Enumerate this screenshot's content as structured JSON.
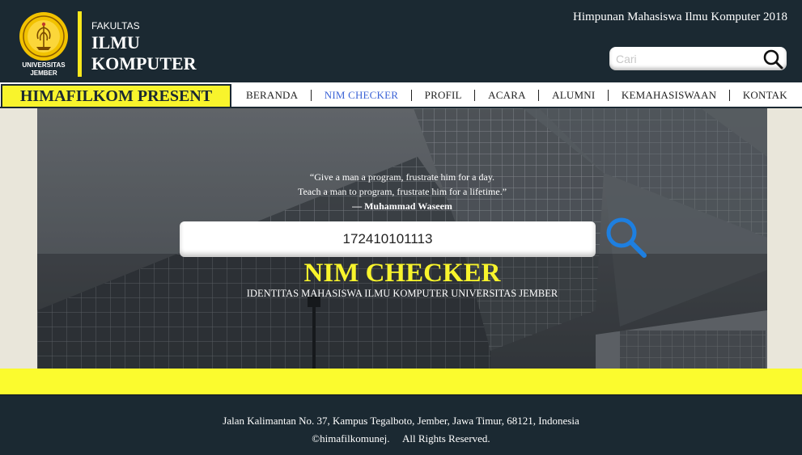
{
  "header": {
    "logo_caption_line1": "UNIVERSITAS",
    "logo_caption_line2": "JEMBER",
    "faculty_small": "FAKULTAS",
    "faculty_line1": "ILMU",
    "faculty_line2": "KOMPUTER",
    "org_title": "Himpunan Mahasiswa Ilmu Komputer 2018",
    "search_placeholder": "Cari",
    "search_icon": "search-icon"
  },
  "nav": {
    "present_label": "HIMAFILKOM PRESENT",
    "links": [
      {
        "label": "BERANDA"
      },
      {
        "label": "NIM CHECKER",
        "active": true
      },
      {
        "label": "PROFIL"
      },
      {
        "label": "ACARA"
      },
      {
        "label": "ALUMNI"
      },
      {
        "label": "KEMAHASISWAAN"
      },
      {
        "label": "KONTAK"
      }
    ]
  },
  "hero": {
    "quote_line1": "“Give a man a program, frustrate him for a day.",
    "quote_line2": "Teach a man to program, frustrate him for a lifetime.”",
    "quote_author": "— Muhammad Waseem",
    "nim_value": "172410101113",
    "search_icon": "search-icon",
    "title": "NIM CHECKER",
    "subtitle": "IDENTITAS MAHASISWA ILMU KOMPUTER UNIVERSITAS JEMBER"
  },
  "footer": {
    "address": "Jalan Kalimantan No. 37, Kampus Tegalboto, Jember, Jawa Timur, 68121, Indonesia",
    "copyright": "©himafilkomunej.     All Rights Reserved."
  },
  "colors": {
    "dark": "#1b2932",
    "yellow": "#f8f42c",
    "accent_link": "#3b63d6",
    "search_blue": "#1e7fe0"
  }
}
